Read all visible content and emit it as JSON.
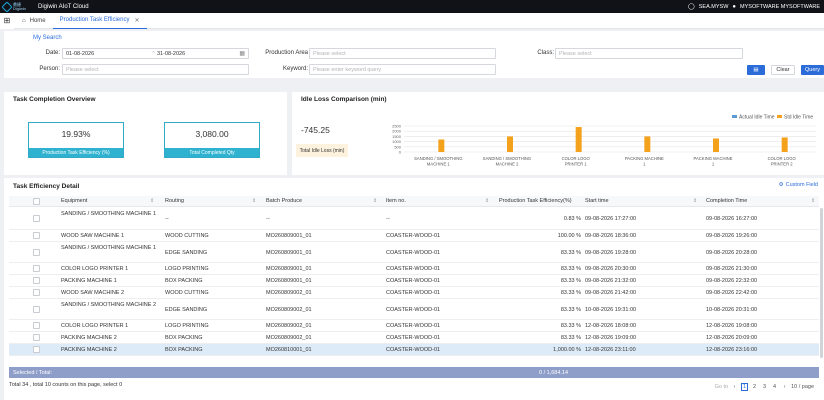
{
  "app": {
    "title": "Digiwin AIoT Cloud",
    "logo_top": "鼎捷",
    "logo_bottom": "Digiwin"
  },
  "user": {
    "region": "SEA.MYSW",
    "tenant": "MYSOFTWARE MYSOFTWARE"
  },
  "tabs": {
    "home": "Home",
    "active": "Production Task Efficiency"
  },
  "search": {
    "title": "My Search",
    "date_label": "Date:",
    "date_from": "01-08-2026",
    "date_to": "31-08-2026",
    "production_area_label": "Production Area",
    "production_area_placeholder": "Please select",
    "class_label": "Class:",
    "class_placeholder": "Please select",
    "person_label": "Person:",
    "person_placeholder": "Please select",
    "keyword_label": "Keyword:",
    "keyword_placeholder": "Please enter keyword query",
    "clear": "Clear",
    "query": "Query"
  },
  "completion": {
    "title": "Task Completion Overview",
    "efficiency_value": "19.93%",
    "efficiency_label": "Production Task Efficiency (%)",
    "qty_value": "3,080.00",
    "qty_label": "Total Completed Qty"
  },
  "idle": {
    "title": "Idle Loss Comparison (min)",
    "total_value": "-745.25",
    "total_label": "Total Idle Loss (min)"
  },
  "chart_data": {
    "type": "bar",
    "categories": [
      "SANDING / SMOOTHING MACHINE 1",
      "SANDING / SMOOTHING MACHINE 2",
      "COLOR LOGO PRINTER 1",
      "PACKING MACHINE 1",
      "PACKING MACHINE 1",
      "COLOR LOGO PRINTER 2"
    ],
    "series": [
      {
        "name": "Actual Idle Time",
        "values": [
          0,
          0,
          0,
          0,
          0,
          0
        ],
        "color": "#5b9bd5"
      },
      {
        "name": "Std Idle Time",
        "values": [
          1200,
          1500,
          2400,
          1500,
          1300,
          1400
        ],
        "color": "#f4a21b"
      }
    ],
    "yticks": [
      "2500",
      "2000",
      "1500",
      "1000",
      "500",
      "0"
    ],
    "ylim": [
      0,
      2500
    ],
    "legend": "top-right",
    "grid": true
  },
  "detail": {
    "title": "Task Efficiency Detail",
    "custom_field": "Custom Field",
    "columns": [
      "Equipment",
      "Routing",
      "Batch Produce",
      "Item no.",
      "Production Task Efficiency(%)",
      "Start time",
      "Completion Time"
    ],
    "rows": [
      {
        "equipment": "SANDING / SMOOTHING MACHINE 1",
        "routing": "--",
        "batch": "--",
        "item": "--",
        "eff": "0.83 %",
        "start": "09-08-2026 17:27:00",
        "end": "09-08-2026 16:27:00"
      },
      {
        "equipment": "WOOD SAW MACHINE 1",
        "routing": "WOOD CUTTING",
        "batch": "MO260809001_01",
        "item": "COASTER-WOOD-01",
        "eff": "100.00 %",
        "start": "09-08-2026 18:36:00",
        "end": "09-08-2026 19:26:00"
      },
      {
        "equipment": "SANDING / SMOOTHING MACHINE 1",
        "routing": "EDGE SANDING",
        "batch": "MO260809001_01",
        "item": "COASTER-WOOD-01",
        "eff": "83.33 %",
        "start": "09-08-2026 19:28:00",
        "end": "09-08-2026 20:28:00"
      },
      {
        "equipment": "COLOR LOGO PRINTER 1",
        "routing": "LOGO PRINTING",
        "batch": "MO260809001_01",
        "item": "COASTER-WOOD-01",
        "eff": "83.33 %",
        "start": "09-08-2026 20:30:00",
        "end": "09-08-2026 21:30:00"
      },
      {
        "equipment": "PACKING MACHINE 1",
        "routing": "BOX PACKING",
        "batch": "MO260809001_01",
        "item": "COASTER-WOOD-01",
        "eff": "83.33 %",
        "start": "09-08-2026 21:32:00",
        "end": "09-08-2026 22:32:00"
      },
      {
        "equipment": "WOOD SAW MACHINE 2",
        "routing": "WOOD CUTTING",
        "batch": "MO260809002_01",
        "item": "COASTER-WOOD-01",
        "eff": "83.33 %",
        "start": "09-08-2026 21:42:00",
        "end": "09-08-2026 22:42:00"
      },
      {
        "equipment": "SANDING / SMOOTHING MACHINE 2",
        "routing": "EDGE SANDING",
        "batch": "MO260809002_01",
        "item": "COASTER-WOOD-01",
        "eff": "83.33 %",
        "start": "10-08-2026 19:31:00",
        "end": "10-08-2026 20:31:00"
      },
      {
        "equipment": "COLOR LOGO PRINTER 1",
        "routing": "LOGO PRINTING",
        "batch": "MO260809002_01",
        "item": "COASTER-WOOD-01",
        "eff": "83.33 %",
        "start": "12-08-2026 18:08:00",
        "end": "12-08-2026 19:08:00"
      },
      {
        "equipment": "PACKING MACHINE 2",
        "routing": "BOX PACKING",
        "batch": "MO260809002_01",
        "item": "COASTER-WOOD-01",
        "eff": "83.33 %",
        "start": "12-08-2026 19:09:00",
        "end": "12-08-2026 20:09:00"
      },
      {
        "equipment": "PACKING MACHINE 2",
        "routing": "BOX PACKING",
        "batch": "MO260810001_01",
        "item": "COASTER-WOOD-01",
        "eff": "1,000.00 %",
        "start": "12-08-2026 23:11:00",
        "end": "12-08-2026 23:16:00"
      }
    ],
    "summary_label": "Selected / Total:",
    "summary_value": "0 / 1,684.14",
    "footer": "Total 34 , total 10 counts on this page, select 0",
    "pager": {
      "goto": "Go to",
      "pages": [
        "1",
        "2",
        "3",
        "4"
      ],
      "per_page": "10 / page"
    }
  }
}
